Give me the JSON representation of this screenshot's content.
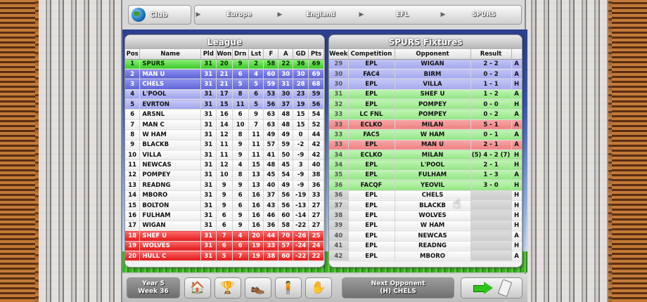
{
  "nav": {
    "club_label": "Club",
    "crumbs": [
      "Europe",
      "England",
      "EFL",
      "SPURS"
    ]
  },
  "league": {
    "title": "League",
    "headers": [
      "Pos",
      "Name",
      "Pld",
      "Won",
      "Drn",
      "Lst",
      "F",
      "A",
      "GD",
      "Pts"
    ],
    "rows": [
      {
        "zone": "green",
        "cells": [
          "1",
          "SPURS",
          "31",
          "20",
          "9",
          "2",
          "58",
          "22",
          "36",
          "69"
        ]
      },
      {
        "zone": "blue",
        "cells": [
          "2",
          "MAN U",
          "31",
          "21",
          "6",
          "4",
          "60",
          "30",
          "30",
          "69"
        ]
      },
      {
        "zone": "blue",
        "cells": [
          "3",
          "CHELS",
          "31",
          "21",
          "5",
          "5",
          "59",
          "31",
          "28",
          "68"
        ]
      },
      {
        "zone": "lblue",
        "cells": [
          "4",
          "L'POOL",
          "31",
          "17",
          "8",
          "6",
          "53",
          "30",
          "23",
          "59"
        ]
      },
      {
        "zone": "lblue",
        "cells": [
          "5",
          "EVRTON",
          "31",
          "15",
          "11",
          "5",
          "56",
          "37",
          "19",
          "56"
        ]
      },
      {
        "zone": "white",
        "cells": [
          "6",
          "ARSNL",
          "31",
          "16",
          "6",
          "9",
          "63",
          "48",
          "15",
          "54"
        ]
      },
      {
        "zone": "white",
        "cells": [
          "7",
          "MAN C",
          "31",
          "14",
          "10",
          "7",
          "63",
          "48",
          "15",
          "52"
        ]
      },
      {
        "zone": "white",
        "cells": [
          "8",
          "W HAM",
          "31",
          "12",
          "8",
          "11",
          "49",
          "49",
          "0",
          "44"
        ]
      },
      {
        "zone": "white",
        "cells": [
          "9",
          "BLACKB",
          "31",
          "11",
          "9",
          "11",
          "57",
          "59",
          "-2",
          "42"
        ]
      },
      {
        "zone": "white",
        "cells": [
          "10",
          "VILLA",
          "31",
          "11",
          "9",
          "11",
          "41",
          "50",
          "-9",
          "42"
        ]
      },
      {
        "zone": "white",
        "cells": [
          "11",
          "NEWCAS",
          "31",
          "12",
          "4",
          "15",
          "48",
          "45",
          "3",
          "40"
        ]
      },
      {
        "zone": "white",
        "cells": [
          "12",
          "POMPEY",
          "31",
          "10",
          "8",
          "13",
          "45",
          "54",
          "-9",
          "38"
        ]
      },
      {
        "zone": "white",
        "cells": [
          "13",
          "READNG",
          "31",
          "9",
          "9",
          "13",
          "40",
          "49",
          "-9",
          "36"
        ]
      },
      {
        "zone": "white",
        "cells": [
          "14",
          "MBORO",
          "31",
          "9",
          "6",
          "16",
          "37",
          "56",
          "-19",
          "33"
        ]
      },
      {
        "zone": "white",
        "cells": [
          "15",
          "BOLTON",
          "31",
          "9",
          "6",
          "16",
          "43",
          "56",
          "-13",
          "27"
        ]
      },
      {
        "zone": "white",
        "cells": [
          "16",
          "FULHAM",
          "31",
          "6",
          "9",
          "16",
          "46",
          "60",
          "-14",
          "27"
        ]
      },
      {
        "zone": "white",
        "cells": [
          "17",
          "WIGAN",
          "31",
          "6",
          "9",
          "16",
          "36",
          "58",
          "-22",
          "27"
        ]
      },
      {
        "zone": "red",
        "cells": [
          "18",
          "SHEF U",
          "31",
          "7",
          "4",
          "20",
          "44",
          "70",
          "-26",
          "25"
        ]
      },
      {
        "zone": "red",
        "cells": [
          "19",
          "WOLVES",
          "31",
          "6",
          "6",
          "19",
          "33",
          "57",
          "-24",
          "24"
        ]
      },
      {
        "zone": "red",
        "cells": [
          "20",
          "HULL C",
          "31",
          "5",
          "7",
          "19",
          "38",
          "60",
          "-22",
          "22"
        ]
      }
    ]
  },
  "fixtures": {
    "title": "SPURS Fixtures",
    "headers": [
      "Week",
      "Competition",
      "Opponent",
      "Result",
      ""
    ],
    "rows": [
      {
        "tone": "blue",
        "cells": [
          "29",
          "EPL",
          "WIGAN",
          "2 - 2",
          "A"
        ]
      },
      {
        "tone": "blue",
        "cells": [
          "30",
          "FAC4",
          "BIRM",
          "0 - 2",
          "A"
        ]
      },
      {
        "tone": "blue",
        "cells": [
          "30",
          "EPL",
          "VILLA",
          "1 - 1",
          "H"
        ]
      },
      {
        "tone": "green",
        "cells": [
          "31",
          "EPL",
          "SHEF U",
          "1 - 2",
          "A"
        ]
      },
      {
        "tone": "green",
        "cells": [
          "32",
          "EPL",
          "POMPEY",
          "0 - 0",
          "H"
        ]
      },
      {
        "tone": "green",
        "cells": [
          "33",
          "LC FNL",
          "POMPEY",
          "0 - 2",
          "A"
        ]
      },
      {
        "tone": "red",
        "cells": [
          "33",
          "ECLKO",
          "MILAN",
          "5 - 1",
          "A"
        ]
      },
      {
        "tone": "green",
        "cells": [
          "33",
          "FAC5",
          "W HAM",
          "0 - 1",
          "A"
        ]
      },
      {
        "tone": "red",
        "cells": [
          "33",
          "EPL",
          "MAN U",
          "2 - 1",
          "A"
        ]
      },
      {
        "tone": "green",
        "cells": [
          "34",
          "ECLKO",
          "MILAN",
          "(5) 4 - 2 (7)",
          "H"
        ]
      },
      {
        "tone": "green",
        "cells": [
          "34",
          "EPL",
          "L'POOL",
          "2 - 1",
          "H"
        ]
      },
      {
        "tone": "green",
        "cells": [
          "35",
          "EPL",
          "FULHAM",
          "1 - 3",
          "A"
        ]
      },
      {
        "tone": "green",
        "cells": [
          "36",
          "FACQF",
          "YEOVIL",
          "3 - 0",
          "H"
        ]
      },
      {
        "tone": "grey",
        "cells": [
          "36",
          "EPL",
          "CHELS",
          "",
          "H"
        ]
      },
      {
        "tone": "grey",
        "cells": [
          "37",
          "EPL",
          "BLACKB",
          "",
          "H"
        ]
      },
      {
        "tone": "grey",
        "cells": [
          "38",
          "EPL",
          "WOLVES",
          "",
          "H"
        ]
      },
      {
        "tone": "grey",
        "cells": [
          "39",
          "EPL",
          "W HAM",
          "",
          "H"
        ]
      },
      {
        "tone": "grey",
        "cells": [
          "40",
          "EPL",
          "NEWCAS",
          "",
          "A"
        ]
      },
      {
        "tone": "grey",
        "cells": [
          "41",
          "EPL",
          "READNG",
          "",
          "H"
        ]
      },
      {
        "tone": "grey",
        "cells": [
          "42",
          "EPL",
          "MBORO",
          "",
          "A"
        ]
      }
    ]
  },
  "bottom": {
    "year": "Year 5",
    "week": "Week 36",
    "icons": [
      "house-icon",
      "trophy-icon",
      "boot-icon",
      "player-icon",
      "hand-icon"
    ],
    "next_opponent_label": "Next Opponent",
    "next_opponent": "(H) CHELS"
  }
}
